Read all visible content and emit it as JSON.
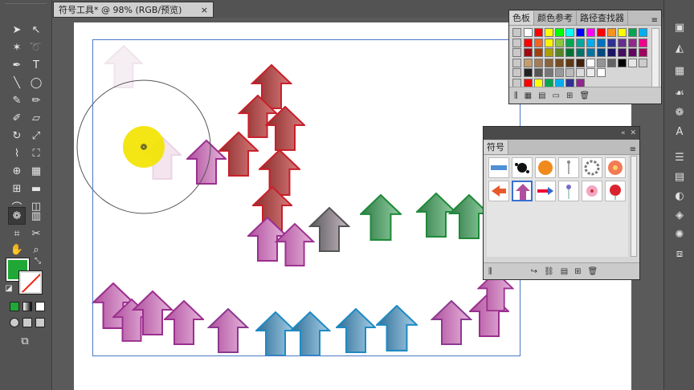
{
  "document": {
    "tab_title": "符号工具* @ 98% (RGB/预览)",
    "close_glyph": "×"
  },
  "swatches_panel": {
    "tabs": [
      "色板",
      "颜色参考",
      "路径查找器"
    ],
    "menu_glyph": "≡",
    "colors_row1": [
      "#ffffff",
      "#ff0000",
      "#ffff00",
      "#00ff00",
      "#00ffff",
      "#0000ff",
      "#ff00ff",
      "#ff0000",
      "#f7931e",
      "#ffff00",
      "#00a651",
      "#00aeef"
    ],
    "colors_row2": [
      "#ff0000",
      "#f26522",
      "#fff200",
      "#8dc63f",
      "#00a651",
      "#00a99d",
      "#00aeef",
      "#0072bc",
      "#2e3192",
      "#662d91",
      "#92278f",
      "#ec008c"
    ],
    "colors_row3": [
      "#9e0b0f",
      "#a0410d",
      "#aba000",
      "#598527",
      "#007236",
      "#00746b",
      "#0076a3",
      "#004a80",
      "#1b1464",
      "#440e62",
      "#630460",
      "#9e005d"
    ],
    "colors_row4": [
      "#c69c6d",
      "#a67c52",
      "#8c6239",
      "#754c24",
      "#603913",
      "#42210b",
      "#ffffff",
      "#959595",
      "#636363",
      "#000000",
      "#e6e6e6",
      "#cccccc"
    ],
    "colors_row5": [
      "#222222",
      "#555555",
      "#777777",
      "#999999",
      "#bbbbbb",
      "#dddddd",
      "#eeeeee",
      "#ffffff"
    ],
    "colors_row6": [
      "#ff0000",
      "#ffff00",
      "#00a651",
      "#00aeef",
      "#2e3192",
      "#92278f"
    ]
  },
  "symbols_panel": {
    "tab": "符号",
    "menu_glyph": "≡",
    "symbols_row1": [
      "blue-banner",
      "ink-splat",
      "orange-button",
      "pin",
      "flower-ring",
      "orange-flower"
    ],
    "symbols_row2": [
      "red-arrow",
      "purple-arrow",
      "rainbow-arrow",
      "iris",
      "pink-flower",
      "red-rose"
    ]
  },
  "colors": {
    "accent": "#1fa836",
    "selection": "#4a78c8"
  }
}
